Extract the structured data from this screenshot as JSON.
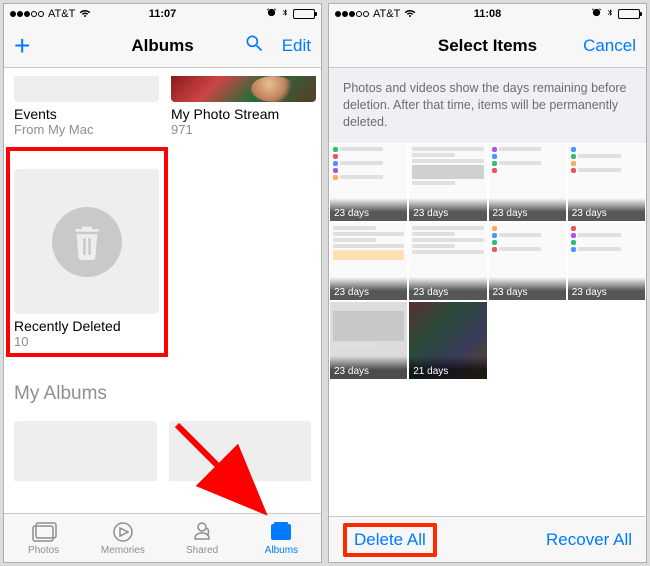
{
  "left": {
    "status": {
      "carrier": "AT&T",
      "time": "11:07"
    },
    "nav": {
      "title": "Albums",
      "edit": "Edit"
    },
    "albums_top": [
      {
        "title": "Events",
        "subtitle": "From My Mac"
      },
      {
        "title": "My Photo Stream",
        "subtitle": "971"
      }
    ],
    "recently_deleted": {
      "title": "Recently Deleted",
      "count": "10"
    },
    "section_my_albums": "My Albums",
    "tabs": {
      "photos": "Photos",
      "memories": "Memories",
      "shared": "Shared",
      "albums": "Albums"
    }
  },
  "right": {
    "status": {
      "carrier": "AT&T",
      "time": "11:08"
    },
    "nav": {
      "title": "Select Items",
      "cancel": "Cancel"
    },
    "info": "Photos and videos show the days remaining before deletion. After that time, items will be permanently deleted.",
    "thumbs": [
      {
        "badge": "23 days"
      },
      {
        "badge": "23 days"
      },
      {
        "badge": "23 days"
      },
      {
        "badge": "23 days"
      },
      {
        "badge": "23 days"
      },
      {
        "badge": "23 days"
      },
      {
        "badge": "23 days"
      },
      {
        "badge": "23 days"
      },
      {
        "badge": "23 days"
      },
      {
        "badge": "21 days"
      }
    ],
    "toolbar": {
      "delete_all": "Delete All",
      "recover_all": "Recover All"
    }
  }
}
